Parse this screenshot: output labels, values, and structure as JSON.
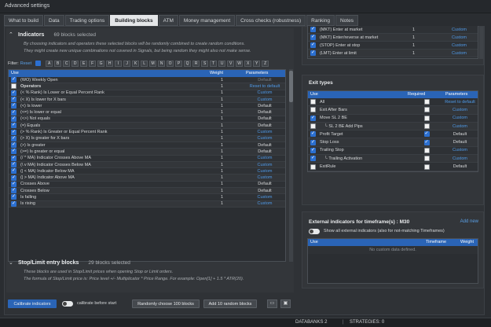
{
  "window": {
    "title": "Advanced settings"
  },
  "tabs": [
    "What to build",
    "Data",
    "Trading options",
    "Building blocks",
    "ATM",
    "Money management",
    "Cross checks (robustness)",
    "Ranking",
    "Notes"
  ],
  "indicators": {
    "title": "Indicators",
    "count": "69 blocks selected",
    "desc1": "By choosing indicators and operators these selected blocks will be randomly combined to create random conditions.",
    "desc2": "They might create new unique combinations not covered in Signals, but being random they might also not make sense.",
    "filter_label": "Filter:",
    "filter_reset": "Reset",
    "letters": [
      "A",
      "B",
      "C",
      "D",
      "E",
      "F",
      "G",
      "H",
      "I",
      "J",
      "K",
      "L",
      "M",
      "N",
      "O",
      "P",
      "Q",
      "R",
      "S",
      "T",
      "U",
      "V",
      "W",
      "X",
      "Y",
      "Z"
    ],
    "cols": {
      "use": "Use",
      "name": "",
      "weight": "Weight",
      "params": "Parameters"
    },
    "rows": [
      {
        "checked": true,
        "name": "(WO) Weekly Open",
        "weight": "1",
        "params": "Default",
        "pstyle": "grey",
        "nstyle": ""
      },
      {
        "checked": false,
        "name": "Operators",
        "weight": "1",
        "params": "Reset to default",
        "pstyle": "blue",
        "nstyle": "bold"
      },
      {
        "checked": true,
        "name": "(< % Rank) Is Lower or Equal Percent Rank",
        "weight": "1",
        "params": "Custom",
        "pstyle": "blue",
        "nstyle": ""
      },
      {
        "checked": true,
        "name": "(< X) Is lower for X bars",
        "weight": "1",
        "params": "Custom",
        "pstyle": "blue",
        "nstyle": ""
      },
      {
        "checked": true,
        "name": "(<) Is lower",
        "weight": "1",
        "params": "Default",
        "pstyle": "",
        "nstyle": ""
      },
      {
        "checked": true,
        "name": "(<=) Is lower or equal",
        "weight": "1",
        "params": "Default",
        "pstyle": "",
        "nstyle": ""
      },
      {
        "checked": true,
        "name": "(<>) Not equals",
        "weight": "1",
        "params": "Default",
        "pstyle": "",
        "nstyle": ""
      },
      {
        "checked": true,
        "name": "(=) Equals",
        "weight": "1",
        "params": "Default",
        "pstyle": "",
        "nstyle": ""
      },
      {
        "checked": true,
        "name": "(> % Rank) Is Greater or Equal Percent Rank",
        "weight": "1",
        "params": "Custom",
        "pstyle": "blue",
        "nstyle": ""
      },
      {
        "checked": true,
        "name": "(> X) Is greater for X bars",
        "weight": "1",
        "params": "Custom",
        "pstyle": "blue",
        "nstyle": ""
      },
      {
        "checked": true,
        "name": "(>) Is greater",
        "weight": "1",
        "params": "Default",
        "pstyle": "",
        "nstyle": ""
      },
      {
        "checked": true,
        "name": "(>=) Is greater or equal",
        "weight": "1",
        "params": "Default",
        "pstyle": "",
        "nstyle": ""
      },
      {
        "checked": true,
        "name": "(/ ^ MA) Indicator Crosses Above MA",
        "weight": "1",
        "params": "Custom",
        "pstyle": "blue",
        "nstyle": ""
      },
      {
        "checked": true,
        "name": "(\\ v MA) Indicator Crosses Below MA",
        "weight": "1",
        "params": "Custom",
        "pstyle": "blue",
        "nstyle": ""
      },
      {
        "checked": true,
        "name": "(| < MA) Indicator Below MA",
        "weight": "1",
        "params": "Custom",
        "pstyle": "blue",
        "nstyle": ""
      },
      {
        "checked": true,
        "name": "(| > MA) Indicator Above MA",
        "weight": "1",
        "params": "Custom",
        "pstyle": "blue",
        "nstyle": ""
      },
      {
        "checked": true,
        "name": "Crosses Above",
        "weight": "1",
        "params": "Default",
        "pstyle": "",
        "nstyle": ""
      },
      {
        "checked": true,
        "name": "Crosses Below",
        "weight": "1",
        "params": "Default",
        "pstyle": "",
        "nstyle": ""
      },
      {
        "checked": true,
        "name": "Is falling",
        "weight": "1",
        "params": "Custom",
        "pstyle": "blue",
        "nstyle": ""
      },
      {
        "checked": true,
        "name": "Is rising",
        "weight": "1",
        "params": "Custom",
        "pstyle": "blue",
        "nstyle": ""
      }
    ]
  },
  "stoplimit": {
    "title": "Stop/Limit entry blocks",
    "count": "29 blocks selected",
    "desc1": "These blocks are used in Stop/Limit prices when opening Stop or Limit orders.",
    "desc2": "The formula of Stop/Limit price is: Price level +/- Multiplicator * Price Range. For example: Open[1] + 1.5 * ATR(20)."
  },
  "bottom": {
    "calibrate": "Calibrate indicators",
    "calibrate_before": "calibrate before start",
    "random_choose": "Randomly choose 100 blocks",
    "add_random": "Add 10 random blocks"
  },
  "orders": {
    "rows": [
      {
        "checked": true,
        "name": "(MKT) Enter at market",
        "weight": "1",
        "params": "Custom"
      },
      {
        "checked": true,
        "name": "(MKT) Enter/reverse at market",
        "weight": "1",
        "params": "Custom"
      },
      {
        "checked": true,
        "name": "(STOP) Enter at stop",
        "weight": "1",
        "params": "Custom"
      },
      {
        "checked": true,
        "name": "(LMT) Enter at limit",
        "weight": "1",
        "params": "Custom"
      }
    ]
  },
  "exit": {
    "title": "Exit types",
    "cols": {
      "use": "Use",
      "name": "",
      "required": "Required",
      "params": "Parameters"
    },
    "rows": [
      {
        "use": false,
        "name": "All",
        "req": false,
        "params": "Reset to default",
        "pstyle": "blue",
        "indent": false
      },
      {
        "use": false,
        "name": "Exit After Bars",
        "req": false,
        "params": "Custom",
        "pstyle": "blue",
        "indent": false
      },
      {
        "use": true,
        "name": "Move SL 2 BE",
        "req": false,
        "params": "Custom",
        "pstyle": "blue",
        "indent": false
      },
      {
        "use": false,
        "name": "└ SL 2 BE Add Pips",
        "req": false,
        "params": "Custom",
        "pstyle": "blue",
        "indent": true
      },
      {
        "use": true,
        "name": "Profit Target",
        "req": true,
        "params": "Default",
        "pstyle": "",
        "indent": false
      },
      {
        "use": true,
        "name": "Stop Loss",
        "req": true,
        "params": "Default",
        "pstyle": "",
        "indent": false
      },
      {
        "use": true,
        "name": "Trailing Stop",
        "req": false,
        "params": "Custom",
        "pstyle": "blue",
        "indent": false
      },
      {
        "use": true,
        "name": "└ Trailing Activation",
        "req": false,
        "params": "Custom",
        "pstyle": "blue",
        "indent": true
      },
      {
        "use": false,
        "name": "ExitRule",
        "req": false,
        "params": "Default",
        "pstyle": "",
        "indent": false
      }
    ]
  },
  "external": {
    "title": "External indicators for timeframe(s) : M30",
    "add_new": "Add new",
    "show_all": "Show all external indicators (also for not-matching Timeframes)",
    "cols": {
      "use": "Use",
      "name": "",
      "timeframe": "Timeframe",
      "weight": "Weight"
    },
    "empty": "No custom data defined."
  },
  "status": {
    "databanks": "DATABANKS 2",
    "strategies": "STRATEGIES: 0"
  }
}
